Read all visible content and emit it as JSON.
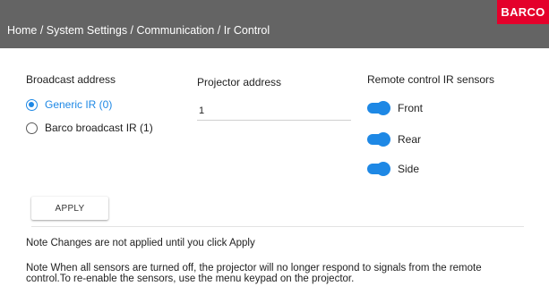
{
  "header": {
    "breadcrumb": "Home / System Settings / Communication / Ir Control",
    "logo_text": "BARCO",
    "background": "#646464",
    "logo_color": "#e4002b"
  },
  "broadcast": {
    "label": "Broadcast address",
    "options": [
      {
        "label": "Generic IR (0)",
        "selected": true
      },
      {
        "label": "Barco broadcast IR (1)",
        "selected": false
      }
    ]
  },
  "projector": {
    "label": "Projector address",
    "value": "1"
  },
  "sensors": {
    "label": "Remote control IR sensors",
    "items": [
      {
        "label": "Front",
        "on": true
      },
      {
        "label": "Rear",
        "on": true
      },
      {
        "label": "Side",
        "on": true
      }
    ]
  },
  "apply_label": "APPLY",
  "notes": {
    "note1": "Note Changes are not applied until you click Apply",
    "note2_line1": "Note When all sensors are turned off, the projector will no longer respond to signals from the remote",
    "note2_line2": "control.To re-enable the sensors, use the menu keypad on the projector."
  },
  "accent_color": "#1e88e5"
}
